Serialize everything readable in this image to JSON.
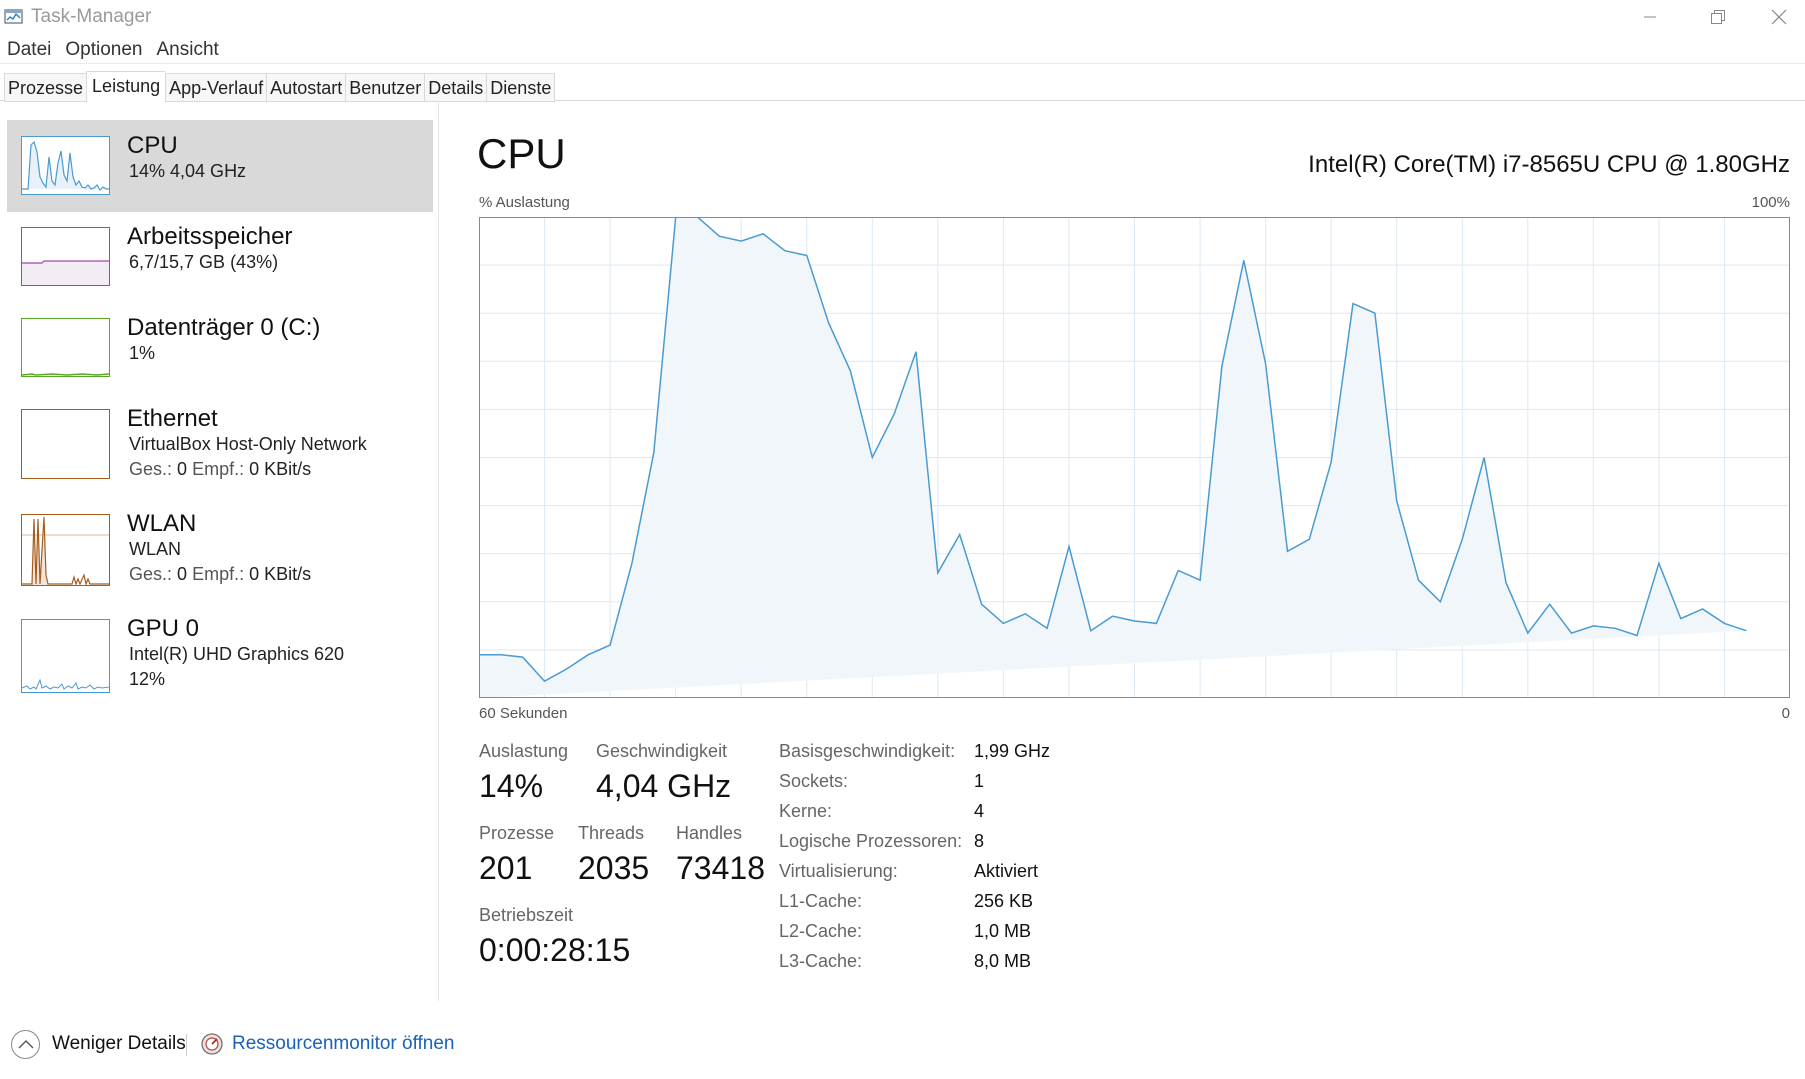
{
  "window": {
    "title": "Task-Manager"
  },
  "menu": [
    "Datei",
    "Optionen",
    "Ansicht"
  ],
  "tabs": [
    {
      "label": "Prozesse",
      "active": false
    },
    {
      "label": "Leistung",
      "active": true
    },
    {
      "label": "App-Verlauf",
      "active": false
    },
    {
      "label": "Autostart",
      "active": false
    },
    {
      "label": "Benutzer",
      "active": false
    },
    {
      "label": "Details",
      "active": false
    },
    {
      "label": "Dienste",
      "active": false
    }
  ],
  "sidebar": {
    "items": [
      {
        "name": "CPU",
        "line1": "14%  4,04 GHz",
        "color": "#4a9bd1"
      },
      {
        "name": "Arbeitsspeicher",
        "line1": "6,7/15,7 GB (43%)",
        "color": "#9c4aa6"
      },
      {
        "name": "Datenträger 0 (C:)",
        "line1": "1%",
        "color": "#5aa82a"
      },
      {
        "name": "Ethernet",
        "line1": "VirtualBox Host-Only Network",
        "line2_send_label": "Ges.:",
        "line2_send": "0",
        "line2_recv_label": "Empf.:",
        "line2_recv": "0 KBit/s",
        "color": "#a75b1c"
      },
      {
        "name": "WLAN",
        "line1": "WLAN",
        "line2_send_label": "Ges.:",
        "line2_send": "0",
        "line2_recv_label": "Empf.:",
        "line2_recv": "0 KBit/s",
        "color": "#a75b1c"
      },
      {
        "name": "GPU 0",
        "line1": "Intel(R) UHD Graphics 620",
        "line2": "12%",
        "color": "#4a9bd1"
      }
    ]
  },
  "main": {
    "title": "CPU",
    "model": "Intel(R) Core(TM) i7-8565U CPU @ 1.80GHz",
    "graph_y_label": "% Auslastung",
    "graph_y_max": "100%",
    "graph_x_left": "60 Sekunden",
    "graph_x_right": "0"
  },
  "chart_data": {
    "type": "area",
    "ylim": [
      0,
      100
    ],
    "x": [
      60,
      59,
      58,
      57,
      56,
      55,
      54,
      53,
      52,
      51,
      50,
      49,
      48,
      47,
      46,
      45,
      44,
      43,
      42,
      41,
      40,
      39,
      38,
      37,
      36,
      35,
      34,
      33,
      32,
      31,
      30,
      29,
      28,
      27,
      26,
      25,
      24,
      23,
      22,
      21,
      20,
      19,
      18,
      17,
      16,
      15,
      14,
      13,
      12,
      11,
      10,
      9,
      8,
      7,
      6,
      5,
      4,
      3,
      2,
      1,
      0
    ],
    "values": [
      9,
      9,
      8.5,
      3.5,
      6,
      9,
      11,
      28,
      51,
      100,
      100,
      96,
      95,
      96.5,
      93,
      92,
      78,
      68,
      50,
      59,
      72,
      26,
      34,
      19.5,
      15.5,
      17.5,
      14.5,
      31.5,
      14,
      17,
      16,
      15.5,
      26.5,
      24.5,
      69,
      91,
      69.5,
      30.5,
      33,
      49,
      82,
      80,
      41,
      24.5,
      20,
      33,
      50,
      24,
      13.5,
      19.5,
      13.5,
      15,
      14.5,
      13,
      28,
      16.5,
      18.5,
      15.5,
      14
    ]
  },
  "stats": {
    "auslastung_label": "Auslastung",
    "auslastung": "14%",
    "speed_label": "Geschwindigkeit",
    "speed": "4,04 GHz",
    "prozesse_label": "Prozesse",
    "prozesse": "201",
    "threads_label": "Threads",
    "threads": "2035",
    "handles_label": "Handles",
    "handles": "73418",
    "uptime_label": "Betriebszeit",
    "uptime": "0:00:28:15"
  },
  "specs": [
    {
      "key": "Basisgeschwindigkeit:",
      "value": "1,99 GHz"
    },
    {
      "key": "Sockets:",
      "value": "1"
    },
    {
      "key": "Kerne:",
      "value": "4"
    },
    {
      "key": "Logische Prozessoren:",
      "value": "8"
    },
    {
      "key": "Virtualisierung:",
      "value": "Aktiviert"
    },
    {
      "key": "L1-Cache:",
      "value": "256 KB"
    },
    {
      "key": "L2-Cache:",
      "value": "1,0 MB"
    },
    {
      "key": "L3-Cache:",
      "value": "8,0 MB"
    }
  ],
  "footer": {
    "less_details": "Weniger Details",
    "resmon": "Ressourcenmonitor öffnen"
  },
  "icons": {
    "app": "task-manager-icon",
    "minimize": "minimize-icon",
    "maximize": "restore-icon",
    "close": "close-icon",
    "chevron": "chevron-up-icon",
    "resmon": "resource-monitor-icon"
  },
  "colors": {
    "cpu_line": "#4a9bd1",
    "cpu_fill": "#f1f6fb",
    "grid": "#dce9f4",
    "link": "#1a62b8",
    "selected_bg": "#d9d9d9"
  }
}
